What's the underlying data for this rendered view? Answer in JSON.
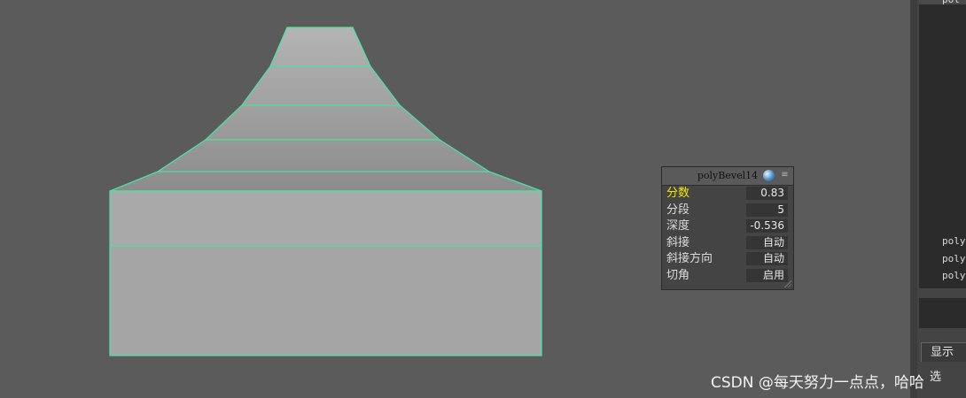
{
  "inview_editor": {
    "title": "polyBevel14",
    "attributes": [
      {
        "label": "分数",
        "value": "0.83"
      },
      {
        "label": "分段",
        "value": "5"
      },
      {
        "label": "深度",
        "value": "-0.536"
      },
      {
        "label": "斜接",
        "value": "自动"
      },
      {
        "label": "斜接方向",
        "value": "自动"
      },
      {
        "label": "切角",
        "value": "启用"
      }
    ],
    "icons": [
      "sphere-icon",
      "menu-icon"
    ]
  },
  "side_panel": {
    "top_text": "pol",
    "history": [
      "poly",
      "poly",
      "poly"
    ],
    "tab_label": "显示",
    "option_label": "选"
  },
  "watermark": "CSDN @每天努力一点点，哈哈",
  "colors": {
    "viewport_bg": "#5b5b5b",
    "mesh_face": "#a5a5a5",
    "mesh_edge": "#4de0a2",
    "active_attr": "#f5e800"
  }
}
